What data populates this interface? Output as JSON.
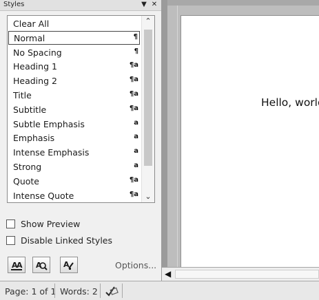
{
  "pane": {
    "title": "Styles",
    "dropdown_glyph": "▼",
    "close_glyph": "✕"
  },
  "styles_list": {
    "items": [
      {
        "label": "Clear All",
        "mark": ""
      },
      {
        "label": "Normal",
        "mark": "¶",
        "selected": true
      },
      {
        "label": "No Spacing",
        "mark": "¶"
      },
      {
        "label": "Heading 1",
        "mark": "¶a"
      },
      {
        "label": "Heading 2",
        "mark": "¶a"
      },
      {
        "label": "Title",
        "mark": "¶a"
      },
      {
        "label": "Subtitle",
        "mark": "¶a"
      },
      {
        "label": "Subtle Emphasis",
        "mark": "a"
      },
      {
        "label": "Emphasis",
        "mark": "a"
      },
      {
        "label": "Intense Emphasis",
        "mark": "a"
      },
      {
        "label": "Strong",
        "mark": "a"
      },
      {
        "label": "Quote",
        "mark": "¶a"
      },
      {
        "label": "Intense Quote",
        "mark": "¶a"
      }
    ],
    "scroll_up": "⌃",
    "scroll_down": "⌄"
  },
  "options": {
    "show_preview": "Show Preview",
    "disable_linked": "Disable Linked Styles",
    "options_link": "Options..."
  },
  "toolbar_icons": [
    "new-style-icon",
    "style-inspector-icon",
    "manage-styles-icon"
  ],
  "document": {
    "text": "Hello, world"
  },
  "status": {
    "page": "Page: 1 of 1",
    "words": "Words: 2",
    "proofing_icon": "proofing-check-icon"
  },
  "hscroll": {
    "left_arrow": "◀"
  }
}
